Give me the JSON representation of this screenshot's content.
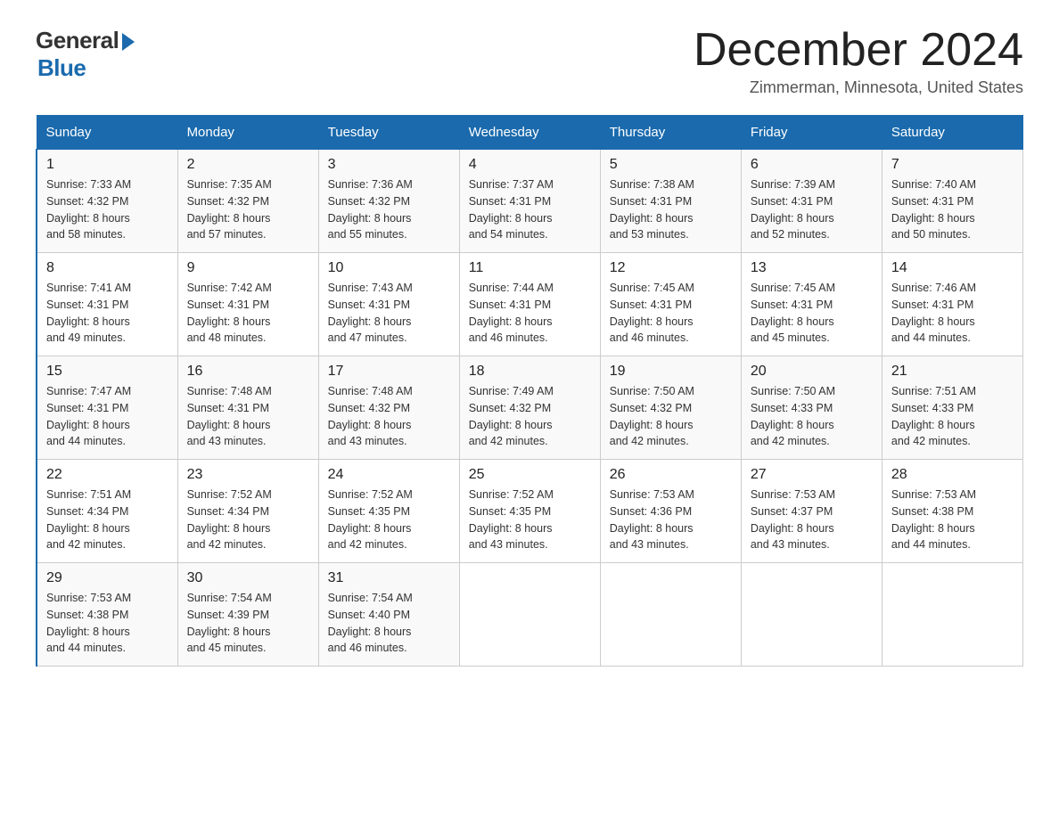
{
  "header": {
    "logo_general": "General",
    "logo_blue": "Blue",
    "month_title": "December 2024",
    "location": "Zimmerman, Minnesota, United States"
  },
  "days_of_week": [
    "Sunday",
    "Monday",
    "Tuesday",
    "Wednesday",
    "Thursday",
    "Friday",
    "Saturday"
  ],
  "weeks": [
    [
      {
        "day": "1",
        "sunrise": "7:33 AM",
        "sunset": "4:32 PM",
        "daylight": "8 hours and 58 minutes."
      },
      {
        "day": "2",
        "sunrise": "7:35 AM",
        "sunset": "4:32 PM",
        "daylight": "8 hours and 57 minutes."
      },
      {
        "day": "3",
        "sunrise": "7:36 AM",
        "sunset": "4:32 PM",
        "daylight": "8 hours and 55 minutes."
      },
      {
        "day": "4",
        "sunrise": "7:37 AM",
        "sunset": "4:31 PM",
        "daylight": "8 hours and 54 minutes."
      },
      {
        "day": "5",
        "sunrise": "7:38 AM",
        "sunset": "4:31 PM",
        "daylight": "8 hours and 53 minutes."
      },
      {
        "day": "6",
        "sunrise": "7:39 AM",
        "sunset": "4:31 PM",
        "daylight": "8 hours and 52 minutes."
      },
      {
        "day": "7",
        "sunrise": "7:40 AM",
        "sunset": "4:31 PM",
        "daylight": "8 hours and 50 minutes."
      }
    ],
    [
      {
        "day": "8",
        "sunrise": "7:41 AM",
        "sunset": "4:31 PM",
        "daylight": "8 hours and 49 minutes."
      },
      {
        "day": "9",
        "sunrise": "7:42 AM",
        "sunset": "4:31 PM",
        "daylight": "8 hours and 48 minutes."
      },
      {
        "day": "10",
        "sunrise": "7:43 AM",
        "sunset": "4:31 PM",
        "daylight": "8 hours and 47 minutes."
      },
      {
        "day": "11",
        "sunrise": "7:44 AM",
        "sunset": "4:31 PM",
        "daylight": "8 hours and 46 minutes."
      },
      {
        "day": "12",
        "sunrise": "7:45 AM",
        "sunset": "4:31 PM",
        "daylight": "8 hours and 46 minutes."
      },
      {
        "day": "13",
        "sunrise": "7:45 AM",
        "sunset": "4:31 PM",
        "daylight": "8 hours and 45 minutes."
      },
      {
        "day": "14",
        "sunrise": "7:46 AM",
        "sunset": "4:31 PM",
        "daylight": "8 hours and 44 minutes."
      }
    ],
    [
      {
        "day": "15",
        "sunrise": "7:47 AM",
        "sunset": "4:31 PM",
        "daylight": "8 hours and 44 minutes."
      },
      {
        "day": "16",
        "sunrise": "7:48 AM",
        "sunset": "4:31 PM",
        "daylight": "8 hours and 43 minutes."
      },
      {
        "day": "17",
        "sunrise": "7:48 AM",
        "sunset": "4:32 PM",
        "daylight": "8 hours and 43 minutes."
      },
      {
        "day": "18",
        "sunrise": "7:49 AM",
        "sunset": "4:32 PM",
        "daylight": "8 hours and 42 minutes."
      },
      {
        "day": "19",
        "sunrise": "7:50 AM",
        "sunset": "4:32 PM",
        "daylight": "8 hours and 42 minutes."
      },
      {
        "day": "20",
        "sunrise": "7:50 AM",
        "sunset": "4:33 PM",
        "daylight": "8 hours and 42 minutes."
      },
      {
        "day": "21",
        "sunrise": "7:51 AM",
        "sunset": "4:33 PM",
        "daylight": "8 hours and 42 minutes."
      }
    ],
    [
      {
        "day": "22",
        "sunrise": "7:51 AM",
        "sunset": "4:34 PM",
        "daylight": "8 hours and 42 minutes."
      },
      {
        "day": "23",
        "sunrise": "7:52 AM",
        "sunset": "4:34 PM",
        "daylight": "8 hours and 42 minutes."
      },
      {
        "day": "24",
        "sunrise": "7:52 AM",
        "sunset": "4:35 PM",
        "daylight": "8 hours and 42 minutes."
      },
      {
        "day": "25",
        "sunrise": "7:52 AM",
        "sunset": "4:35 PM",
        "daylight": "8 hours and 43 minutes."
      },
      {
        "day": "26",
        "sunrise": "7:53 AM",
        "sunset": "4:36 PM",
        "daylight": "8 hours and 43 minutes."
      },
      {
        "day": "27",
        "sunrise": "7:53 AM",
        "sunset": "4:37 PM",
        "daylight": "8 hours and 43 minutes."
      },
      {
        "day": "28",
        "sunrise": "7:53 AM",
        "sunset": "4:38 PM",
        "daylight": "8 hours and 44 minutes."
      }
    ],
    [
      {
        "day": "29",
        "sunrise": "7:53 AM",
        "sunset": "4:38 PM",
        "daylight": "8 hours and 44 minutes."
      },
      {
        "day": "30",
        "sunrise": "7:54 AM",
        "sunset": "4:39 PM",
        "daylight": "8 hours and 45 minutes."
      },
      {
        "day": "31",
        "sunrise": "7:54 AM",
        "sunset": "4:40 PM",
        "daylight": "8 hours and 46 minutes."
      },
      null,
      null,
      null,
      null
    ]
  ],
  "labels": {
    "sunrise": "Sunrise:",
    "sunset": "Sunset:",
    "daylight": "Daylight:"
  }
}
